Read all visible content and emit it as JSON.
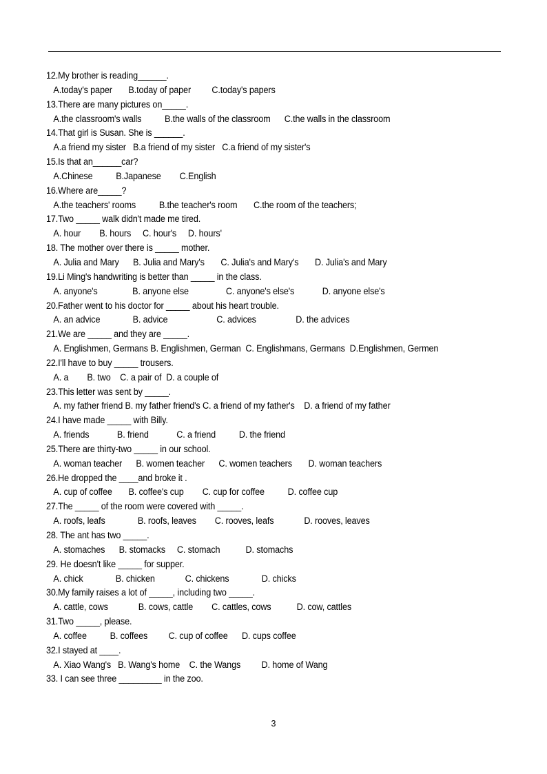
{
  "document": {
    "page_number": "3",
    "header_rule": true,
    "lines": [
      {
        "type": "question",
        "text": "12.My brother is reading______."
      },
      {
        "type": "options",
        "text": "A.today's paper       B.today of paper         C.today's papers"
      },
      {
        "type": "question",
        "text": "13.There are many pictures on_____."
      },
      {
        "type": "options",
        "text": "A.the classroom's walls          B.the walls of the classroom      C.the walls in the classroom"
      },
      {
        "type": "question",
        "text": "14.That girl is Susan. She is ______."
      },
      {
        "type": "options",
        "text": "A.a friend my sister   B.a friend of my sister   C.a friend of my sister's"
      },
      {
        "type": "question",
        "text": "15.Is that an______car?"
      },
      {
        "type": "options",
        "text": "A.Chinese          B.Japanese        C.English"
      },
      {
        "type": "question",
        "text": "16.Where are_____?"
      },
      {
        "type": "options",
        "text": "A.the teachers' rooms          B.the teacher's room       C.the room of the teachers;"
      },
      {
        "type": "question",
        "text": "17.Two _____ walk didn't made me tired."
      },
      {
        "type": "options",
        "text": "A. hour        B. hours     C. hour's     D. hours'"
      },
      {
        "type": "question",
        "text": "18. The mother over there is _____ mother."
      },
      {
        "type": "options",
        "text": "A. Julia and Mary      B. Julia and Mary's       C. Julia's and Mary's       D. Julia's and Mary"
      },
      {
        "type": "question",
        "text": "19.Li Ming's handwriting is better than _____ in the class."
      },
      {
        "type": "options",
        "text": "A. anyone's               B. anyone else                C. anyone's else's            D. anyone else's"
      },
      {
        "type": "question",
        "text": "20.Father went to his doctor for _____ about his heart trouble."
      },
      {
        "type": "options",
        "text": "A. an advice              B. advice                     C. advices                 D. the advices"
      },
      {
        "type": "question",
        "text": "21.We are _____ and they are _____."
      },
      {
        "type": "options",
        "text": "A. Englishmen, Germans B. Englishmen, German  C. Englishmans, Germans  D.Englishmen, Germen"
      },
      {
        "type": "question",
        "text": "22.I'll have to buy _____ trousers."
      },
      {
        "type": "options",
        "text": "A. a        B. two    C. a pair of  D. a couple of"
      },
      {
        "type": "question",
        "text": "23.This letter was sent by _____."
      },
      {
        "type": "options",
        "text": "A. my father friend B. my father friend's C. a friend of my father's    D. a friend of my father"
      },
      {
        "type": "question",
        "text": "24.I have made _____ with Billy."
      },
      {
        "type": "options",
        "text": "A. friends            B. friend            C. a friend          D. the friend"
      },
      {
        "type": "question",
        "text": "25.There are thirty-two _____ in our school."
      },
      {
        "type": "options",
        "text": "A. woman teacher      B. women teacher      C. women teachers       D. woman teachers"
      },
      {
        "type": "question",
        "text": "26.He dropped the ____and broke it ."
      },
      {
        "type": "options",
        "text": "A. cup of coffee       B. coffee's cup        C. cup for coffee          D. coffee cup"
      },
      {
        "type": "question",
        "text": "27.The _____ of the room were covered with _____."
      },
      {
        "type": "options",
        "text": "A. roofs, leafs              B. roofs, leaves        C. rooves, leafs             D. rooves, leaves"
      },
      {
        "type": "question",
        "text": "28. The ant has two _____."
      },
      {
        "type": "options",
        "text": "A. stomaches      B. stomacks     C. stomach           D. stomachs"
      },
      {
        "type": "question",
        "text": "29. He doesn't like _____ for supper."
      },
      {
        "type": "options",
        "text": "A. chick              B. chicken             C. chickens              D. chicks"
      },
      {
        "type": "question",
        "text": "30.My family raises a lot of _____, including two _____."
      },
      {
        "type": "options",
        "text": "A. cattle, cows             B. cows, cattle        C. cattles, cows           D. cow, cattles"
      },
      {
        "type": "question",
        "text": "31.Two _____, please."
      },
      {
        "type": "options",
        "text": "A. coffee          B. coffees         C. cup of coffee      D. cups coffee"
      },
      {
        "type": "question",
        "text": "32.I stayed at ____."
      },
      {
        "type": "options",
        "text": "A. Xiao Wang's   B. Wang's home    C. the Wangs         D. home of Wang"
      },
      {
        "type": "question",
        "text": "33. I can see three _________ in the zoo."
      }
    ]
  }
}
